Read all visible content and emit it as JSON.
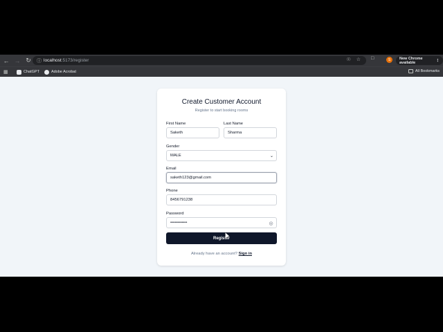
{
  "browser": {
    "url_host": "localhost",
    "url_path": ":5173/register",
    "update_label": "New Chrome available",
    "profile_initial": "S",
    "bookmarks": [
      {
        "label": "ChatGPT"
      },
      {
        "label": "Adobe Acrobat"
      }
    ],
    "all_bookmarks_label": "All Bookmarks"
  },
  "form": {
    "title": "Create Customer Account",
    "subtitle": "Register to start booking rooms",
    "first_name": {
      "label": "First Name",
      "value": "Saketh"
    },
    "last_name": {
      "label": "Last Name",
      "value": "Sharma"
    },
    "gender": {
      "label": "Gender",
      "value": "MALE"
    },
    "email": {
      "label": "Email",
      "value": "saketh123@gmail.com"
    },
    "phone": {
      "label": "Phone",
      "value": "8456791238"
    },
    "password": {
      "label": "Password",
      "value": "••••••••••••"
    },
    "submit_label": "Register",
    "footer_text": "Already have an account?",
    "signin_label": "Sign in"
  }
}
